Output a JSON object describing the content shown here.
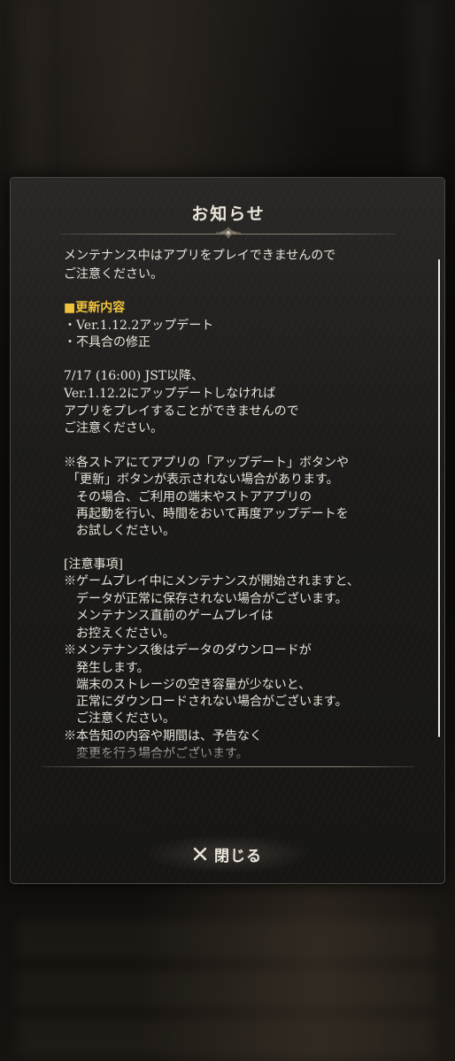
{
  "dialog": {
    "title": "お知らせ",
    "close_label": "閉じる",
    "close_icon": "close-icon",
    "ornament_icon": "ornament-divider-icon"
  },
  "notice": {
    "lines": [
      "メンテナンス中はアプリをプレイできませんので",
      "ご注意ください。",
      "",
      "■更新内容",
      "・Ver.1.12.2アップデート",
      "・不具合の修正",
      "",
      "7/17 (16:00) JST以降、",
      "Ver.1.12.2にアップデートしなければ",
      "アプリをプレイすることができませんので",
      "ご注意ください。",
      "",
      "※各ストアにてアプリの「アップデート」ボタンや",
      "「更新」ボタンが表示されない場合があります。",
      "その場合、ご利用の端末やストアアプリの",
      "再起動を行い、時間をおいて再度アップデートを",
      "お試しください。",
      "",
      "[注意事項]",
      "※ゲームプレイ中にメンテナンスが開始されますと、",
      "データが正常に保存されない場合がございます。",
      "メンテナンス直前のゲームプレイは",
      "お控えください。",
      "※メンテナンス後はデータのダウンロードが",
      "発生します。",
      "端末のストレージの空き容量が少ないと、",
      "正常にダウンロードされない場合がございます。",
      "ご注意ください。",
      "※本告知の内容や期間は、予告なく",
      "変更を行う場合がございます。"
    ]
  },
  "colors": {
    "heading": "#f0c23c",
    "body_text": "#e8e3da",
    "title": "#ece6da",
    "panel": "#1c1b19"
  }
}
